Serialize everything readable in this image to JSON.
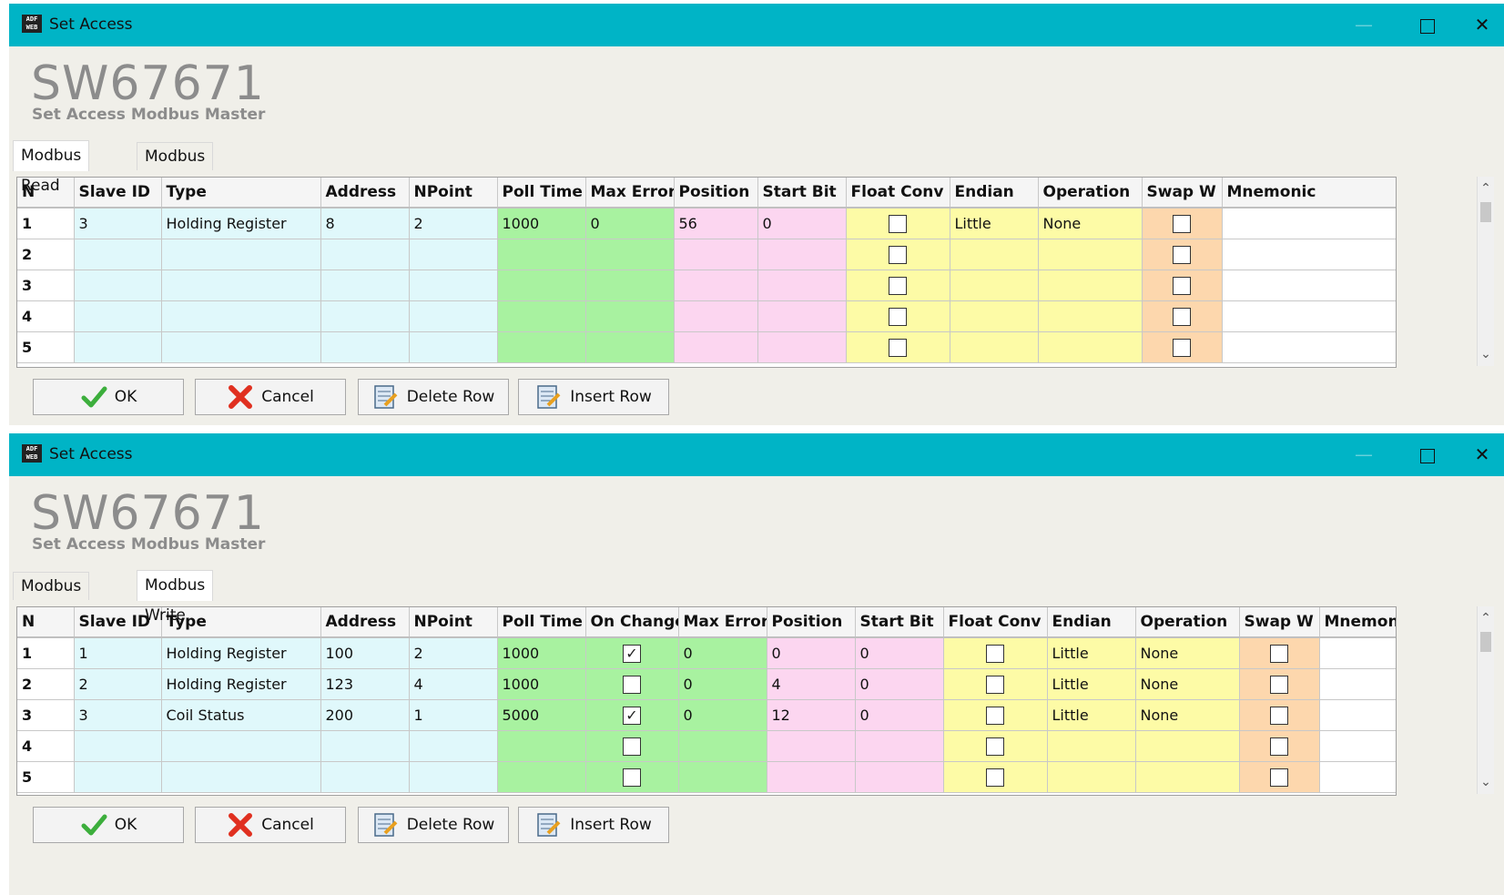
{
  "window_title": "Set Access",
  "app_icon_text": "ADF WEB",
  "product_code": "SW67671",
  "product_subtitle": "Set Access Modbus Master",
  "tabs": [
    "Modbus Read",
    "Modbus Write"
  ],
  "buttons": {
    "ok": "OK",
    "cancel": "Cancel",
    "delete_row": "Delete Row",
    "insert_row": "Insert Row"
  },
  "read_table": {
    "headers": [
      "N",
      "Slave ID",
      "Type",
      "Address",
      "NPoint",
      "Poll Time",
      "Max Error",
      "Position",
      "Start Bit",
      "Float Conv",
      "Endian",
      "Operation",
      "Swap W",
      "Mnemonic"
    ],
    "rows": [
      {
        "n": "1",
        "slave_id": "3",
        "type": "Holding Register",
        "address": "8",
        "npoint": "2",
        "poll_time": "1000",
        "max_error": "0",
        "position": "56",
        "start_bit": "0",
        "float_conv": false,
        "endian": "Little",
        "operation": "None",
        "swap_w": false,
        "mnemonic": ""
      },
      {
        "n": "2",
        "slave_id": "",
        "type": "",
        "address": "",
        "npoint": "",
        "poll_time": "",
        "max_error": "",
        "position": "",
        "start_bit": "",
        "float_conv": false,
        "endian": "",
        "operation": "",
        "swap_w": false,
        "mnemonic": ""
      },
      {
        "n": "3",
        "slave_id": "",
        "type": "",
        "address": "",
        "npoint": "",
        "poll_time": "",
        "max_error": "",
        "position": "",
        "start_bit": "",
        "float_conv": false,
        "endian": "",
        "operation": "",
        "swap_w": false,
        "mnemonic": ""
      },
      {
        "n": "4",
        "slave_id": "",
        "type": "",
        "address": "",
        "npoint": "",
        "poll_time": "",
        "max_error": "",
        "position": "",
        "start_bit": "",
        "float_conv": false,
        "endian": "",
        "operation": "",
        "swap_w": false,
        "mnemonic": ""
      },
      {
        "n": "5",
        "slave_id": "",
        "type": "",
        "address": "",
        "npoint": "",
        "poll_time": "",
        "max_error": "",
        "position": "",
        "start_bit": "",
        "float_conv": false,
        "endian": "",
        "operation": "",
        "swap_w": false,
        "mnemonic": ""
      }
    ]
  },
  "write_table": {
    "headers": [
      "N",
      "Slave ID",
      "Type",
      "Address",
      "NPoint",
      "Poll Time",
      "On Change",
      "Max Error",
      "Position",
      "Start Bit",
      "Float Conv",
      "Endian",
      "Operation",
      "Swap W",
      "Mnemonic"
    ],
    "rows": [
      {
        "n": "1",
        "slave_id": "1",
        "type": "Holding Register",
        "address": "100",
        "npoint": "2",
        "poll_time": "1000",
        "on_change": true,
        "max_error": "0",
        "position": "0",
        "start_bit": "0",
        "float_conv": false,
        "endian": "Little",
        "operation": "None",
        "swap_w": false,
        "mnemonic": ""
      },
      {
        "n": "2",
        "slave_id": "2",
        "type": "Holding Register",
        "address": "123",
        "npoint": "4",
        "poll_time": "1000",
        "on_change": false,
        "max_error": "0",
        "position": "4",
        "start_bit": "0",
        "float_conv": false,
        "endian": "Little",
        "operation": "None",
        "swap_w": false,
        "mnemonic": ""
      },
      {
        "n": "3",
        "slave_id": "3",
        "type": "Coil Status",
        "address": "200",
        "npoint": "1",
        "poll_time": "5000",
        "on_change": true,
        "max_error": "0",
        "position": "12",
        "start_bit": "0",
        "float_conv": false,
        "endian": "Little",
        "operation": "None",
        "swap_w": false,
        "mnemonic": ""
      },
      {
        "n": "4",
        "slave_id": "",
        "type": "",
        "address": "",
        "npoint": "",
        "poll_time": "",
        "on_change": false,
        "max_error": "",
        "position": "",
        "start_bit": "",
        "float_conv": false,
        "endian": "",
        "operation": "",
        "swap_w": false,
        "mnemonic": ""
      },
      {
        "n": "5",
        "slave_id": "",
        "type": "",
        "address": "",
        "npoint": "",
        "poll_time": "",
        "on_change": false,
        "max_error": "",
        "position": "",
        "start_bit": "",
        "float_conv": false,
        "endian": "",
        "operation": "",
        "swap_w": false,
        "mnemonic": ""
      }
    ]
  },
  "colors": {
    "titlebar": "#00b4c6",
    "id_cols": "#e0f8fb",
    "poll_cols": "#a8f2a0",
    "position_cols": "#fcd6f0",
    "format_cols": "#fdfba6",
    "swap_col": "#fdd7ad"
  }
}
